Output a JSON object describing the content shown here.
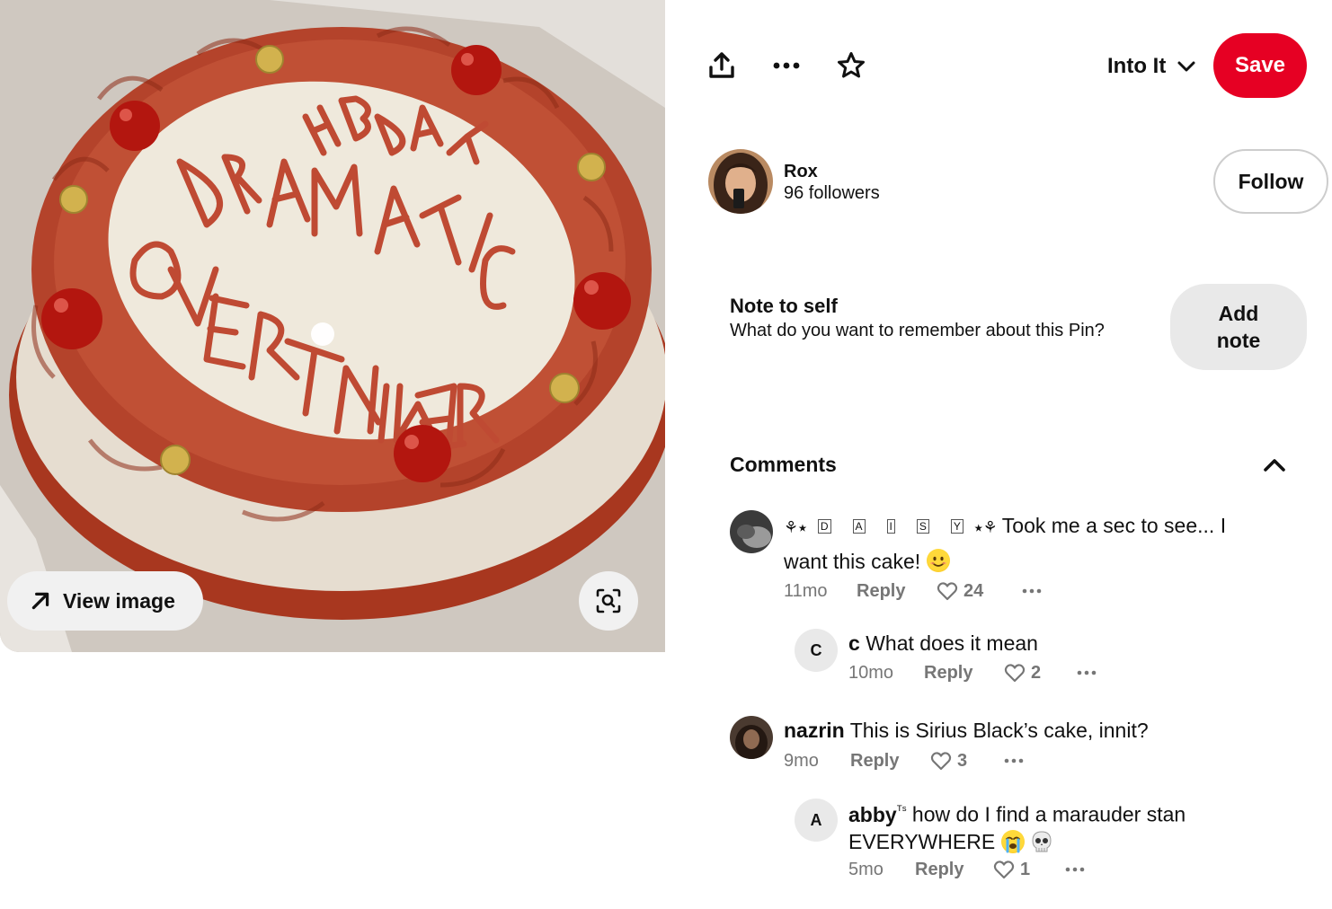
{
  "toolbar": {
    "share_icon": "share-upload-icon",
    "more_icon": "more-horizontal-icon",
    "favorite_icon": "star-icon",
    "board_name": "Into It",
    "save_label": "Save"
  },
  "image": {
    "view_image_label": "View image",
    "lens_icon": "visual-search-icon",
    "cake_text_lines": [
      "HBDAY",
      "DRAMATIC",
      "OVERTHINKER"
    ]
  },
  "creator": {
    "name": "Rox",
    "followers": "96 followers",
    "follow_label": "Follow"
  },
  "note": {
    "title": "Note to self",
    "description": "What do you want to remember about this Pin?",
    "add_label_line1": "Add",
    "add_label_line2": "note"
  },
  "comments": {
    "heading": "Comments",
    "items": [
      {
        "author_prefix": "⚘⭑",
        "author_letters": [
          "D",
          "A",
          "I",
          "S",
          "Y"
        ],
        "author_suffix": "⭑⚘",
        "text_line1": "Took me a sec to see... I",
        "text_line2": "want this cake!",
        "emoji": "smiling-face",
        "time": "11mo",
        "reply_label": "Reply",
        "likes": "24"
      },
      {
        "avatar_letter": "C",
        "author": "c",
        "text": "What does it mean",
        "time": "10mo",
        "reply_label": "Reply",
        "likes": "2"
      },
      {
        "author": "nazrin",
        "text": "This is Sirius Black’s cake, innit?",
        "time": "9mo",
        "reply_label": "Reply",
        "likes": "3"
      },
      {
        "avatar_letter": "A",
        "author": "abby",
        "author_sup": "ᵀˢ",
        "text_line1": "how do I find a marauder stan",
        "text_line2": "EVERYWHERE",
        "emojis": [
          "loudly-crying-face",
          "skull"
        ],
        "time": "5mo",
        "reply_label": "Reply",
        "likes": "1"
      }
    ]
  },
  "colors": {
    "save_red": "#e60023",
    "frosting": "#b8472f",
    "cake_top": "#efe9dc",
    "muted_text": "#767676"
  }
}
